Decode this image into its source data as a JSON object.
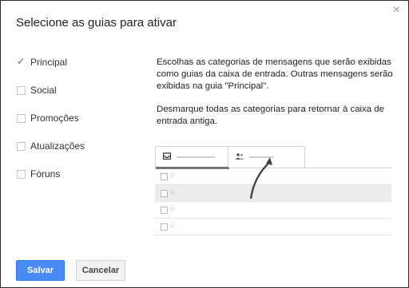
{
  "dialog": {
    "title": "Selecione as guias para ativar",
    "close_symbol": "×"
  },
  "options": [
    {
      "label": "Principal",
      "checked": true
    },
    {
      "label": "Social",
      "checked": false
    },
    {
      "label": "Promoções",
      "checked": false
    },
    {
      "label": "Atualizações",
      "checked": false
    },
    {
      "label": "Fóruns",
      "checked": false
    }
  ],
  "description": {
    "paragraph1": "Escolhas as categorias de mensagens que serão exibidas como guias da caixa de entrada. Outras mensagens serão exibidas na guia \"Principal\".",
    "paragraph2": "Desmarque todas as categorias para retornar à caixa de entrada antiga."
  },
  "preview": {
    "tab1_icon": "inbox-icon",
    "tab2_icon": "people-icon",
    "star_symbol": "☆"
  },
  "buttons": {
    "save": "Salvar",
    "cancel": "Cancelar"
  },
  "colors": {
    "primary_button": "#4a8af4",
    "tab_underline": "#777777"
  }
}
